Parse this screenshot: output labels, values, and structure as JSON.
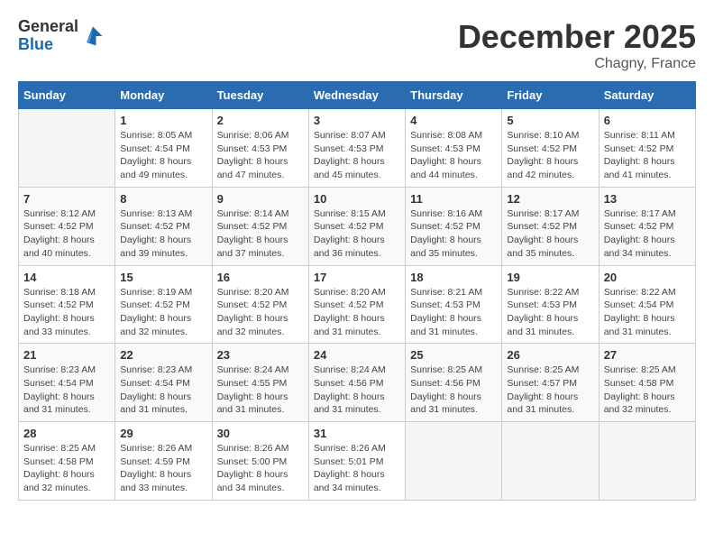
{
  "header": {
    "logo_general": "General",
    "logo_blue": "Blue",
    "month": "December 2025",
    "location": "Chagny, France"
  },
  "days_of_week": [
    "Sunday",
    "Monday",
    "Tuesday",
    "Wednesday",
    "Thursday",
    "Friday",
    "Saturday"
  ],
  "weeks": [
    [
      {
        "day": "",
        "sunrise": "",
        "sunset": "",
        "daylight": ""
      },
      {
        "day": "1",
        "sunrise": "Sunrise: 8:05 AM",
        "sunset": "Sunset: 4:54 PM",
        "daylight": "Daylight: 8 hours and 49 minutes."
      },
      {
        "day": "2",
        "sunrise": "Sunrise: 8:06 AM",
        "sunset": "Sunset: 4:53 PM",
        "daylight": "Daylight: 8 hours and 47 minutes."
      },
      {
        "day": "3",
        "sunrise": "Sunrise: 8:07 AM",
        "sunset": "Sunset: 4:53 PM",
        "daylight": "Daylight: 8 hours and 45 minutes."
      },
      {
        "day": "4",
        "sunrise": "Sunrise: 8:08 AM",
        "sunset": "Sunset: 4:53 PM",
        "daylight": "Daylight: 8 hours and 44 minutes."
      },
      {
        "day": "5",
        "sunrise": "Sunrise: 8:10 AM",
        "sunset": "Sunset: 4:52 PM",
        "daylight": "Daylight: 8 hours and 42 minutes."
      },
      {
        "day": "6",
        "sunrise": "Sunrise: 8:11 AM",
        "sunset": "Sunset: 4:52 PM",
        "daylight": "Daylight: 8 hours and 41 minutes."
      }
    ],
    [
      {
        "day": "7",
        "sunrise": "Sunrise: 8:12 AM",
        "sunset": "Sunset: 4:52 PM",
        "daylight": "Daylight: 8 hours and 40 minutes."
      },
      {
        "day": "8",
        "sunrise": "Sunrise: 8:13 AM",
        "sunset": "Sunset: 4:52 PM",
        "daylight": "Daylight: 8 hours and 39 minutes."
      },
      {
        "day": "9",
        "sunrise": "Sunrise: 8:14 AM",
        "sunset": "Sunset: 4:52 PM",
        "daylight": "Daylight: 8 hours and 37 minutes."
      },
      {
        "day": "10",
        "sunrise": "Sunrise: 8:15 AM",
        "sunset": "Sunset: 4:52 PM",
        "daylight": "Daylight: 8 hours and 36 minutes."
      },
      {
        "day": "11",
        "sunrise": "Sunrise: 8:16 AM",
        "sunset": "Sunset: 4:52 PM",
        "daylight": "Daylight: 8 hours and 35 minutes."
      },
      {
        "day": "12",
        "sunrise": "Sunrise: 8:17 AM",
        "sunset": "Sunset: 4:52 PM",
        "daylight": "Daylight: 8 hours and 35 minutes."
      },
      {
        "day": "13",
        "sunrise": "Sunrise: 8:17 AM",
        "sunset": "Sunset: 4:52 PM",
        "daylight": "Daylight: 8 hours and 34 minutes."
      }
    ],
    [
      {
        "day": "14",
        "sunrise": "Sunrise: 8:18 AM",
        "sunset": "Sunset: 4:52 PM",
        "daylight": "Daylight: 8 hours and 33 minutes."
      },
      {
        "day": "15",
        "sunrise": "Sunrise: 8:19 AM",
        "sunset": "Sunset: 4:52 PM",
        "daylight": "Daylight: 8 hours and 32 minutes."
      },
      {
        "day": "16",
        "sunrise": "Sunrise: 8:20 AM",
        "sunset": "Sunset: 4:52 PM",
        "daylight": "Daylight: 8 hours and 32 minutes."
      },
      {
        "day": "17",
        "sunrise": "Sunrise: 8:20 AM",
        "sunset": "Sunset: 4:52 PM",
        "daylight": "Daylight: 8 hours and 31 minutes."
      },
      {
        "day": "18",
        "sunrise": "Sunrise: 8:21 AM",
        "sunset": "Sunset: 4:53 PM",
        "daylight": "Daylight: 8 hours and 31 minutes."
      },
      {
        "day": "19",
        "sunrise": "Sunrise: 8:22 AM",
        "sunset": "Sunset: 4:53 PM",
        "daylight": "Daylight: 8 hours and 31 minutes."
      },
      {
        "day": "20",
        "sunrise": "Sunrise: 8:22 AM",
        "sunset": "Sunset: 4:54 PM",
        "daylight": "Daylight: 8 hours and 31 minutes."
      }
    ],
    [
      {
        "day": "21",
        "sunrise": "Sunrise: 8:23 AM",
        "sunset": "Sunset: 4:54 PM",
        "daylight": "Daylight: 8 hours and 31 minutes."
      },
      {
        "day": "22",
        "sunrise": "Sunrise: 8:23 AM",
        "sunset": "Sunset: 4:54 PM",
        "daylight": "Daylight: 8 hours and 31 minutes."
      },
      {
        "day": "23",
        "sunrise": "Sunrise: 8:24 AM",
        "sunset": "Sunset: 4:55 PM",
        "daylight": "Daylight: 8 hours and 31 minutes."
      },
      {
        "day": "24",
        "sunrise": "Sunrise: 8:24 AM",
        "sunset": "Sunset: 4:56 PM",
        "daylight": "Daylight: 8 hours and 31 minutes."
      },
      {
        "day": "25",
        "sunrise": "Sunrise: 8:25 AM",
        "sunset": "Sunset: 4:56 PM",
        "daylight": "Daylight: 8 hours and 31 minutes."
      },
      {
        "day": "26",
        "sunrise": "Sunrise: 8:25 AM",
        "sunset": "Sunset: 4:57 PM",
        "daylight": "Daylight: 8 hours and 31 minutes."
      },
      {
        "day": "27",
        "sunrise": "Sunrise: 8:25 AM",
        "sunset": "Sunset: 4:58 PM",
        "daylight": "Daylight: 8 hours and 32 minutes."
      }
    ],
    [
      {
        "day": "28",
        "sunrise": "Sunrise: 8:25 AM",
        "sunset": "Sunset: 4:58 PM",
        "daylight": "Daylight: 8 hours and 32 minutes."
      },
      {
        "day": "29",
        "sunrise": "Sunrise: 8:26 AM",
        "sunset": "Sunset: 4:59 PM",
        "daylight": "Daylight: 8 hours and 33 minutes."
      },
      {
        "day": "30",
        "sunrise": "Sunrise: 8:26 AM",
        "sunset": "Sunset: 5:00 PM",
        "daylight": "Daylight: 8 hours and 34 minutes."
      },
      {
        "day": "31",
        "sunrise": "Sunrise: 8:26 AM",
        "sunset": "Sunset: 5:01 PM",
        "daylight": "Daylight: 8 hours and 34 minutes."
      },
      {
        "day": "",
        "sunrise": "",
        "sunset": "",
        "daylight": ""
      },
      {
        "day": "",
        "sunrise": "",
        "sunset": "",
        "daylight": ""
      },
      {
        "day": "",
        "sunrise": "",
        "sunset": "",
        "daylight": ""
      }
    ]
  ]
}
